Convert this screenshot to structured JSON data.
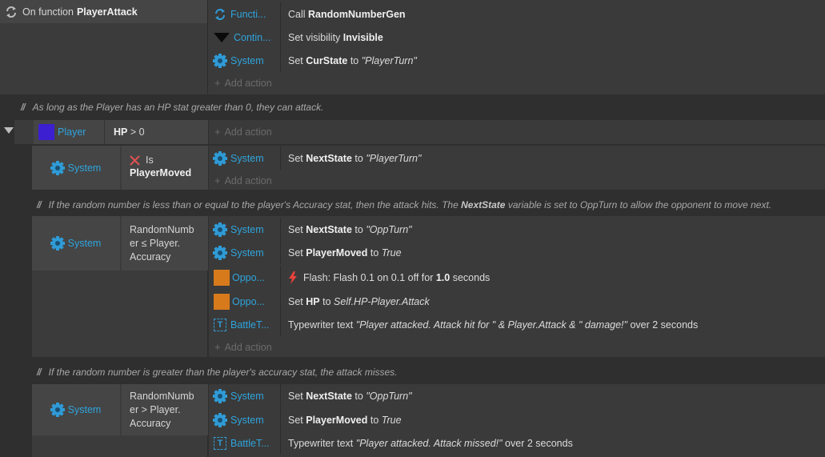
{
  "function_block": {
    "label": "On function",
    "name": "PlayerAttack",
    "actions": [
      {
        "object": "Functi...",
        "verb": "Call",
        "bold": "RandomNumberGen"
      },
      {
        "object": "Contin...",
        "verb": "Set visibility",
        "bold": "Invisible"
      },
      {
        "object": "System",
        "verb": "Set",
        "bold": "CurState",
        "mid": "to",
        "value": "\"PlayerTurn\""
      }
    ],
    "add_action": "Add action"
  },
  "comment1": "As long as the Player has an HP stat greater than 0, they can attack.",
  "player_event": {
    "object": "Player",
    "condition_bold": "HP",
    "condition_rest": "> 0",
    "add_action": "Add action"
  },
  "sub1": {
    "object": "System",
    "cond_prefix": "Is",
    "cond_bold": "PlayerMoved",
    "actions": [
      {
        "object": "System",
        "verb": "Set",
        "bold": "NextState",
        "mid": "to",
        "value": "\"PlayerTurn\""
      }
    ],
    "add_action": "Add action"
  },
  "comment2": {
    "before": "If the random number is less than or equal to the player's Accuracy stat, then the attack hits. The",
    "bold": "NextState",
    "after": "variable is set to OppTurn to allow the opponent to move next."
  },
  "sub2": {
    "object": "System",
    "cond_lines": [
      "RandomNumb",
      "er ≤ Player.",
      "Accuracy"
    ],
    "actions": [
      {
        "object": "System",
        "verb": "Set",
        "bold": "NextState",
        "mid": "to",
        "value": "\"OppTurn\""
      },
      {
        "object": "System",
        "verb": "Set",
        "bold": "PlayerMoved",
        "mid": "to",
        "value": "True"
      },
      {
        "object": "Oppo...",
        "flash": "Flash: Flash 0.1 on 0.1 off for",
        "flash_bold": "1.0",
        "flash_end": "seconds"
      },
      {
        "object": "Oppo...",
        "verb": "Set",
        "bold": "HP",
        "mid": "to",
        "value": "Self.HP-Player.Attack"
      },
      {
        "object": "BattleT...",
        "verb": "Typewriter text",
        "value": "\"Player attacked. Attack hit for \" & Player.Attack & \" damage!\"",
        "tail": "over 2 seconds"
      }
    ],
    "add_action": "Add action"
  },
  "comment3": "If the random number is greater than the player's accuracy stat, the attack misses.",
  "sub3": {
    "object": "System",
    "cond_lines": [
      "RandomNumb",
      "er > Player.",
      "Accuracy"
    ],
    "actions": [
      {
        "object": "System",
        "verb": "Set",
        "bold": "NextState",
        "mid": "to",
        "value": "\"OppTurn\""
      },
      {
        "object": "System",
        "verb": "Set",
        "bold": "PlayerMoved",
        "mid": "to",
        "value": "True"
      },
      {
        "object": "BattleT...",
        "verb": "Typewriter text",
        "value": "\"Player attacked. Attack missed!\"",
        "tail": "over 2 seconds"
      }
    ]
  },
  "colors": {
    "object_link": "#2fa4dd",
    "orange_object": "#d67a1c",
    "player_object": "#3c1fd0",
    "flash_icon": "#e8423a",
    "x_icon": "#e05252"
  },
  "icons": [
    "loop-arrows-icon",
    "function-icon",
    "arrow-down-icon",
    "gear-icon",
    "orange-square-icon",
    "blue-square-icon",
    "lightning-icon",
    "x-icon",
    "text-object-icon",
    "collapse-triangle-icon",
    "plus-icon"
  ]
}
